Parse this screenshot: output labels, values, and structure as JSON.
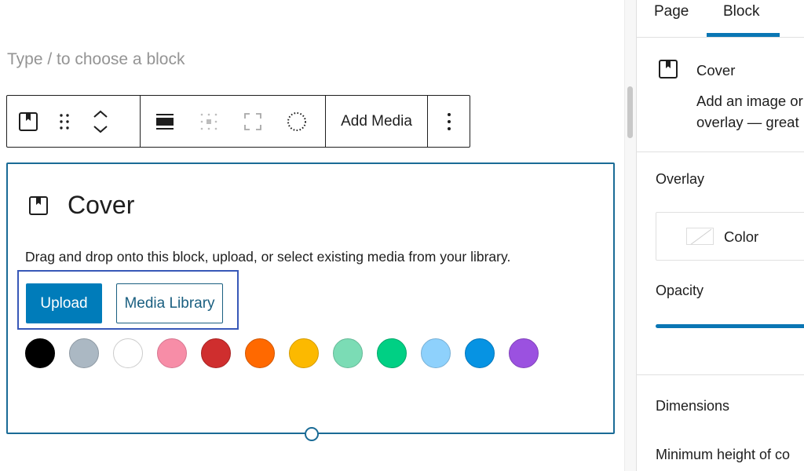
{
  "editor": {
    "placeholder": "Type / to choose a block",
    "toolbar": {
      "block_icon": "cover-bookmark-icon",
      "drag_icon": "drag-handle-icon",
      "move_icon": "move-up-down-icon",
      "align_icon": "align-full-icon",
      "position_icon": "content-position-icon",
      "fullheight_icon": "fullscreen-icon",
      "duotone_icon": "duotone-circle-icon",
      "add_media_label": "Add Media",
      "more_icon": "more-vertical-icon"
    },
    "cover_block": {
      "title": "Cover",
      "instructions": "Drag and drop onto this block, upload, or select existing media from your library.",
      "upload_label": "Upload",
      "media_library_label": "Media Library",
      "swatches": [
        {
          "name": "black",
          "color": "#000000",
          "border": "#000000"
        },
        {
          "name": "cyan-bluish-gray",
          "color": "#abb8c3",
          "border": "#8e99a3"
        },
        {
          "name": "white",
          "color": "#ffffff",
          "border": "#cccccc"
        },
        {
          "name": "pale-pink",
          "color": "#f78da7",
          "border": "#d67790"
        },
        {
          "name": "vivid-red",
          "color": "#cf2e2e",
          "border": "#a82424"
        },
        {
          "name": "luminous-vivid-orange",
          "color": "#ff6900",
          "border": "#d15700"
        },
        {
          "name": "luminous-vivid-amber",
          "color": "#fcb900",
          "border": "#d49b00"
        },
        {
          "name": "light-green-cyan",
          "color": "#7bdcb5",
          "border": "#67b998"
        },
        {
          "name": "vivid-green-cyan",
          "color": "#00d084",
          "border": "#00a86b"
        },
        {
          "name": "pale-cyan-blue",
          "color": "#8ed1fc",
          "border": "#78b0d6"
        },
        {
          "name": "vivid-cyan-blue",
          "color": "#0693e3",
          "border": "#0577bb"
        },
        {
          "name": "vivid-purple",
          "color": "#9b51e0",
          "border": "#8043ba"
        }
      ]
    }
  },
  "sidebar": {
    "tabs": [
      {
        "label": "Page",
        "active": false
      },
      {
        "label": "Block",
        "active": true
      }
    ],
    "block_card": {
      "title": "Cover",
      "description_line1": "Add an image or",
      "description_line2": "overlay — great"
    },
    "overlay": {
      "title": "Overlay",
      "color_label": "Color",
      "opacity_label": "Opacity"
    },
    "dimensions": {
      "title": "Dimensions",
      "min_height_label": "Minimum height of co"
    }
  },
  "colors": {
    "accent": "#007cba",
    "selection_border": "#1a6b96",
    "focus_outline": "#3858b8"
  }
}
